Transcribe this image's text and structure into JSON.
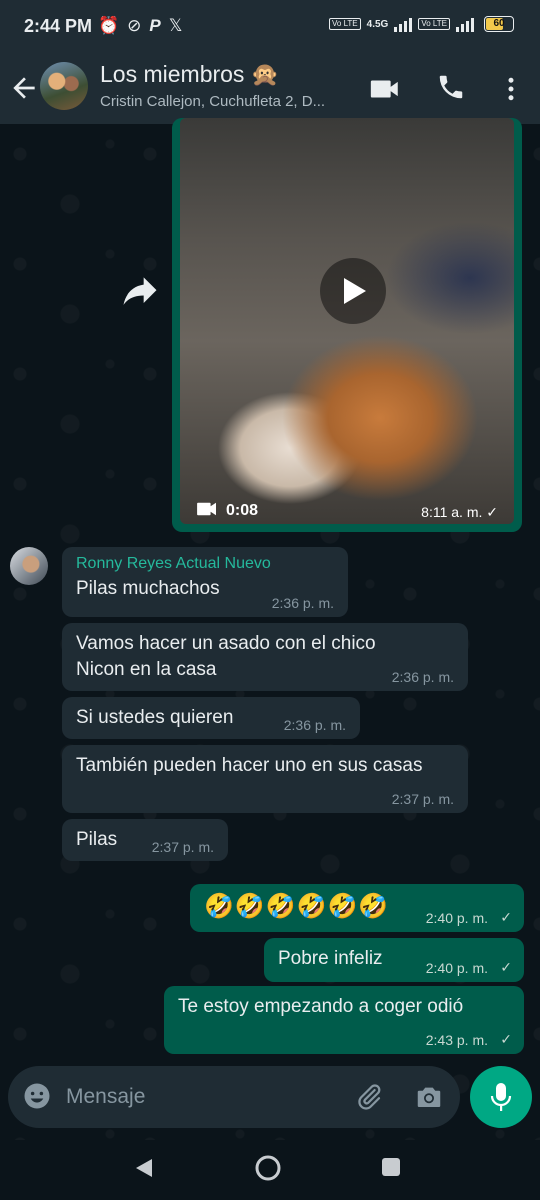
{
  "status_bar": {
    "time": "2:44 PM",
    "network": "4.5G",
    "lte_1": "Vo LTE",
    "lte_2": "Vo LTE",
    "battery": "60"
  },
  "header": {
    "title": "Los miembros 🙊",
    "subtitle": "Cristin Callejon, Cuchufleta 2, D..."
  },
  "video_message": {
    "duration": "0:08",
    "time": "8:11 a. m.",
    "status": "✓"
  },
  "incoming": {
    "sender": "Ronny Reyes Actual Nuevo",
    "messages": [
      {
        "text": "Pilas muchachos",
        "time": "2:36 p. m."
      },
      {
        "text": "Vamos hacer un asado con el chico Nicon en la casa",
        "time": "2:36 p. m."
      },
      {
        "text": "Si ustedes quieren",
        "time": "2:36 p. m."
      },
      {
        "text": "También pueden hacer uno en sus casas",
        "time": "2:37 p. m."
      },
      {
        "text": "Pilas",
        "time": "2:37 p. m."
      }
    ]
  },
  "outgoing": [
    {
      "text": "🤣🤣🤣🤣🤣🤣",
      "time": "2:40 p. m.",
      "status": "✓"
    },
    {
      "text": "Pobre infeliz",
      "time": "2:40 p. m.",
      "status": "✓"
    },
    {
      "text": "Te estoy empezando a coger odió",
      "time": "2:43 p. m.",
      "status": "✓"
    }
  ],
  "composer": {
    "placeholder": "Mensaje"
  },
  "colors": {
    "background": "#0b141a",
    "bar": "#1f2c34",
    "outgoing_bubble": "#005c4b",
    "incoming_bubble": "#1f2c34",
    "accent": "#00a884",
    "sender_name": "#25b99c"
  }
}
